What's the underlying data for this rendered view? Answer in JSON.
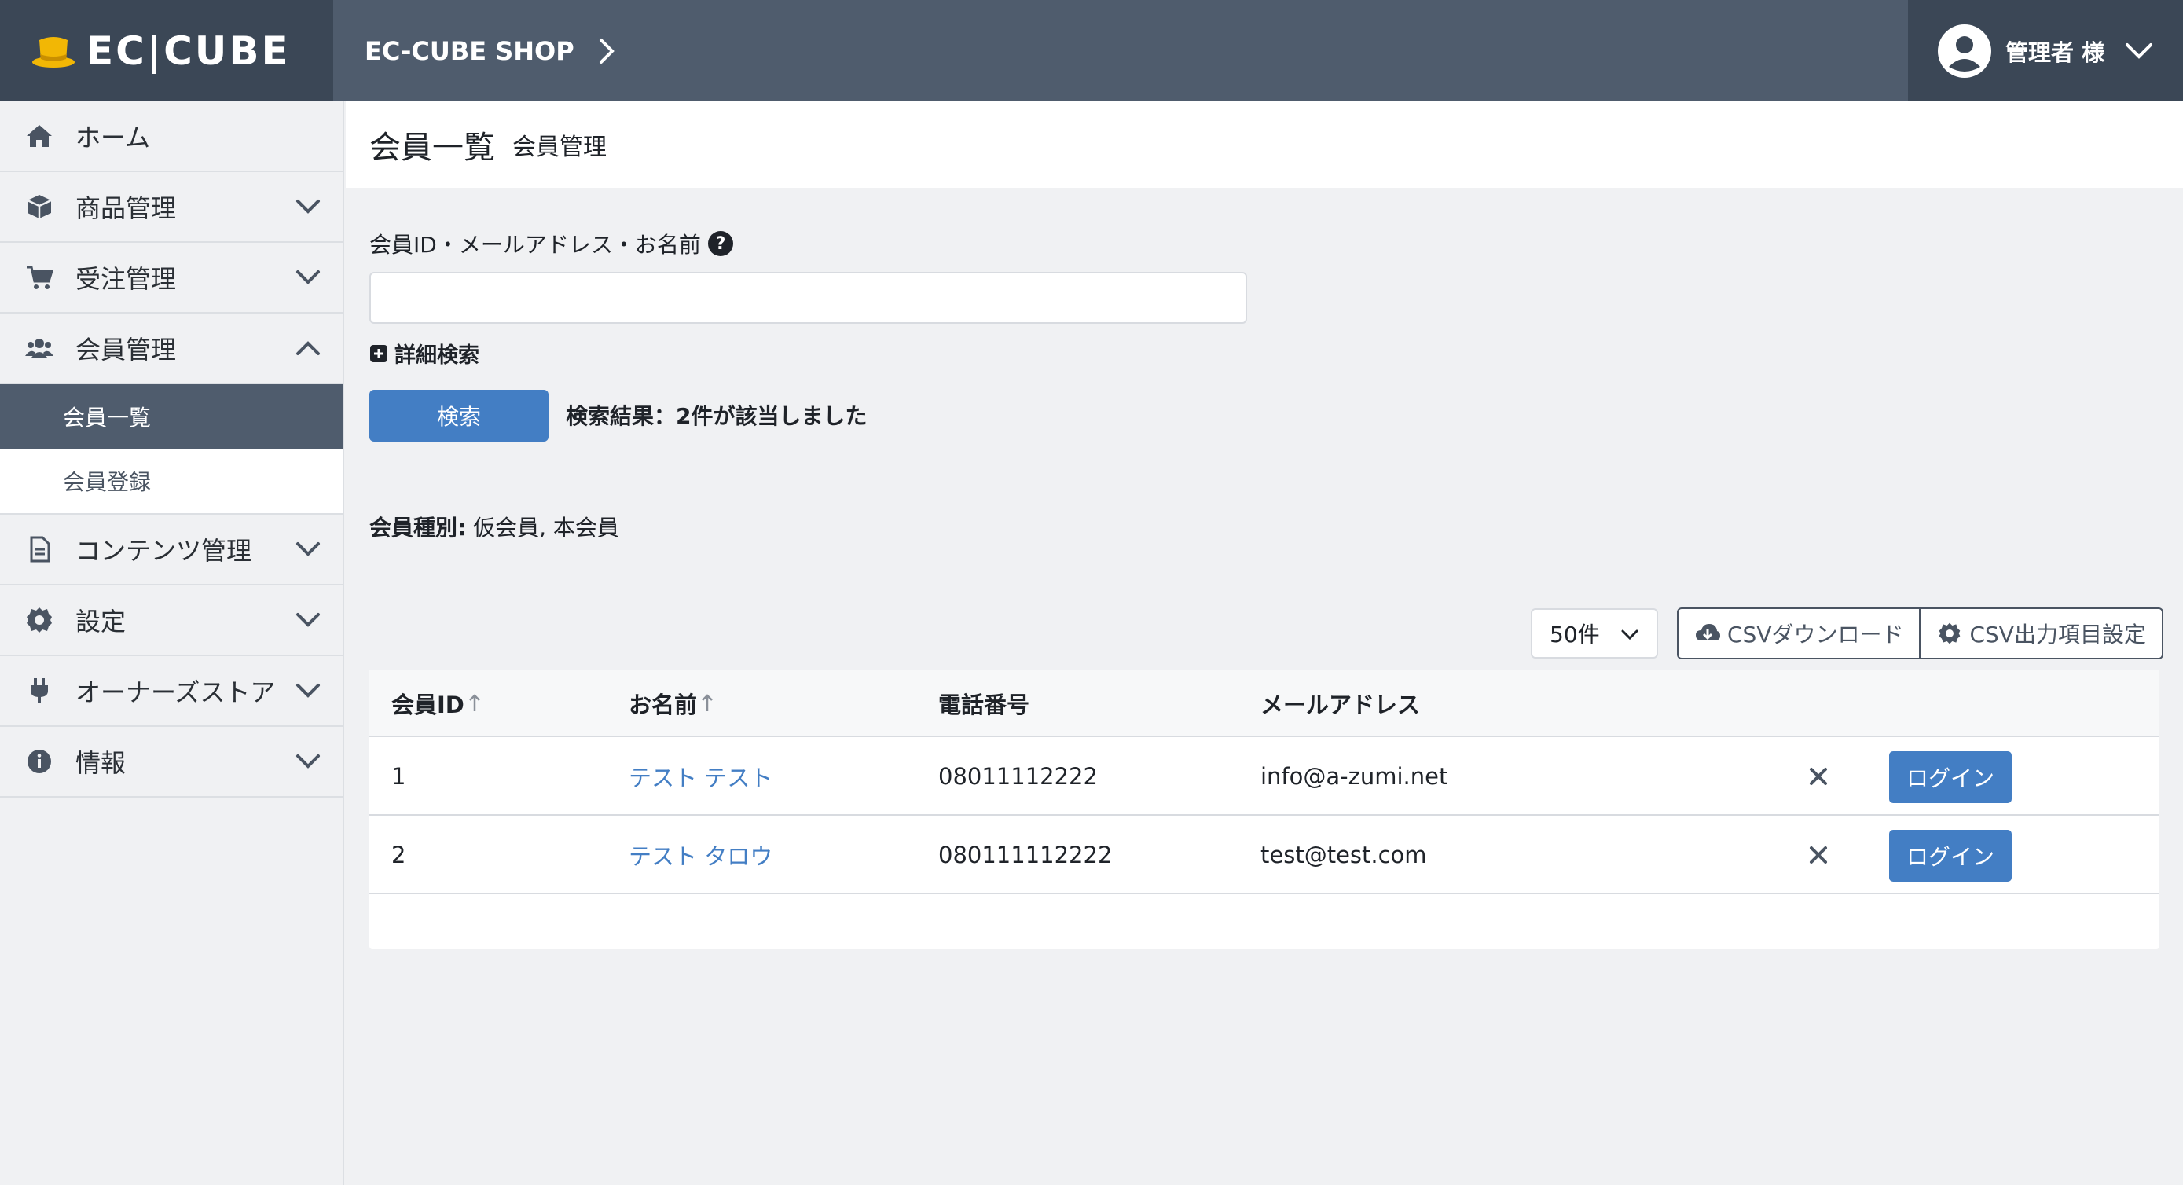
{
  "header": {
    "logo_text": "EC|CUBE",
    "shop_name": "EC-CUBE SHOP",
    "user_name": "管理者 様"
  },
  "sidebar": {
    "items": [
      {
        "label": "ホーム",
        "icon": "home-icon"
      },
      {
        "label": "商品管理",
        "icon": "box-icon"
      },
      {
        "label": "受注管理",
        "icon": "cart-icon"
      },
      {
        "label": "会員管理",
        "icon": "users-icon"
      },
      {
        "label": "コンテンツ管理",
        "icon": "file-icon"
      },
      {
        "label": "設定",
        "icon": "gear-icon"
      },
      {
        "label": "オーナーズストア",
        "icon": "plug-icon"
      },
      {
        "label": "情報",
        "icon": "info-icon"
      }
    ],
    "sub_items": [
      {
        "label": "会員一覧",
        "active": true
      },
      {
        "label": "会員登録",
        "active": false
      }
    ]
  },
  "page": {
    "title": "会員一覧",
    "subtitle": "会員管理"
  },
  "search": {
    "label": "会員ID・メールアドレス・お名前",
    "value": "",
    "placeholder": "",
    "advanced_label": "詳細検索",
    "button_label": "検索",
    "result_text": "検索結果：2件が該当しました"
  },
  "filter": {
    "member_type_label": "会員種別:",
    "member_type_value": "仮会員, 本会員"
  },
  "toolbar": {
    "per_page": "50件",
    "csv_download": "CSVダウンロード",
    "csv_settings": "CSV出力項目設定"
  },
  "table": {
    "headers": [
      "会員ID",
      "お名前",
      "電話番号",
      "メールアドレス"
    ],
    "rows": [
      {
        "id": "1",
        "name": "テスト テスト",
        "phone": "08011112222",
        "email": "info@a-zumi.net",
        "login": "ログイン"
      },
      {
        "id": "2",
        "name": "テスト タロウ",
        "phone": "080111112222",
        "email": "test@test.com",
        "login": "ログイン"
      }
    ]
  },
  "colors": {
    "header_bg": "#4f5c6d",
    "header_dark": "#3b4756",
    "accent": "#437ec4",
    "logo_yellow": "#f2b705"
  }
}
